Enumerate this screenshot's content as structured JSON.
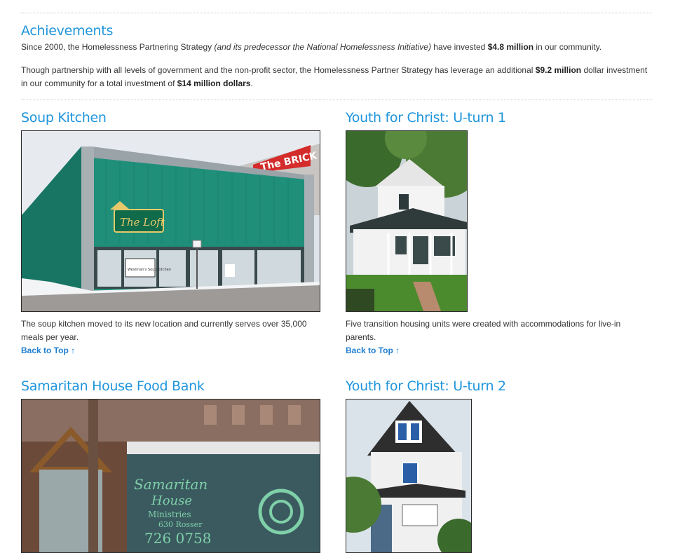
{
  "achievements": {
    "title": "Achievements",
    "p1": {
      "a": "Since 2000, the Homelessness Partnering Strategy ",
      "em": "(and its predecessor the National Homelessness Initiative)",
      "b": " have invested ",
      "strong": "$4.8 million",
      "c": " in our community."
    },
    "p2": {
      "a": "Though partnership with all levels of government and the non-profit sector, the Homelessness Partner Strategy has leverage an additional ",
      "strong1": "$9.2 million",
      "b": " dollar investment in our community for a total investment of ",
      "strong2": "$14 million dollars",
      "c": "."
    }
  },
  "projects": [
    {
      "title": "Soup Kitchen",
      "caption": "The soup kitchen moved to its new location and currently serves over 35,000 meals per year.",
      "back": "Back to Top ↑",
      "sign_brick": "The BRICK",
      "sign_loft": "The Loft",
      "sign_window": "Westman's Soup Kitchen"
    },
    {
      "title": "Youth for Christ: U-turn 1",
      "caption": "Five transition housing units were created with accommodations for live-in parents.",
      "back": "Back to Top ↑"
    },
    {
      "title": "Samaritan House Food Bank",
      "sign_line1": "Samaritan",
      "sign_line2": "House",
      "sign_line3": "Ministries",
      "sign_line4": "630 Rosser",
      "sign_phone": "726 0758"
    },
    {
      "title": "Youth for Christ: U-turn 2"
    }
  ],
  "colors": {
    "heading": "#1e95dc",
    "link": "#1e7ed0",
    "building_green": "#1f8f7a"
  }
}
